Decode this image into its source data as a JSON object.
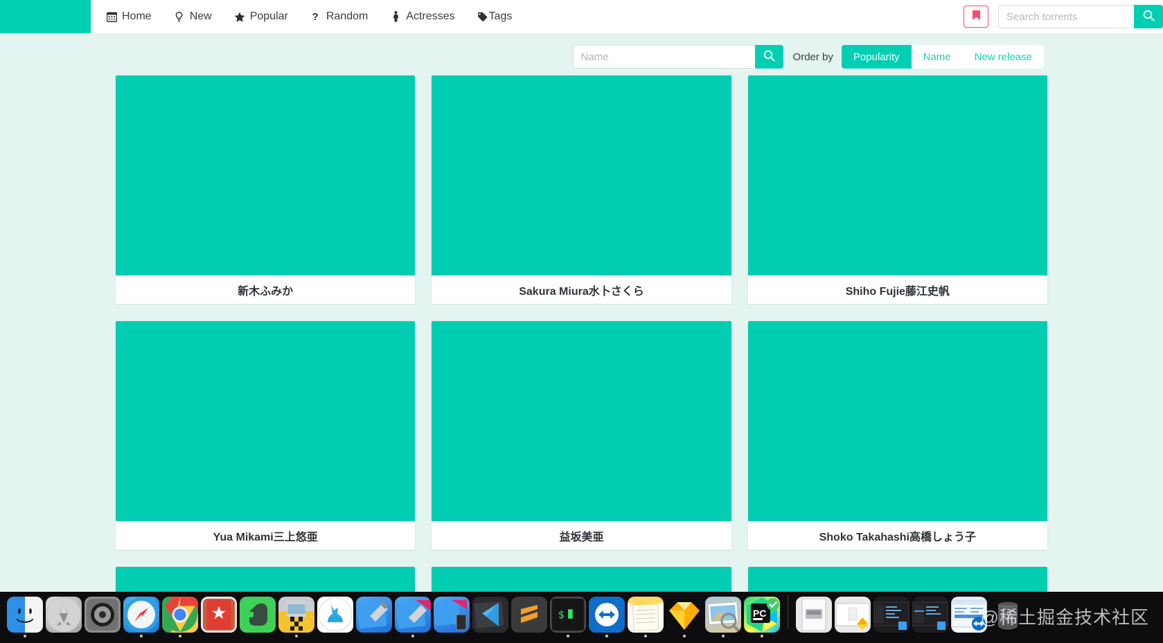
{
  "navbar": {
    "brand": "",
    "links": [
      {
        "label": "Home",
        "icon": "calendar-icon"
      },
      {
        "label": "New",
        "icon": "lightbulb-icon"
      },
      {
        "label": "Popular",
        "icon": "star-icon"
      },
      {
        "label": "Random",
        "icon": "question-mark-icon"
      },
      {
        "label": "Actresses",
        "icon": "person-icon"
      },
      {
        "label": "Tags",
        "icon": "tag-icon"
      }
    ],
    "bookmark_icon": "bookmark-icon",
    "search": {
      "placeholder": "Search torrents",
      "value": "",
      "button_icon": "search-icon"
    }
  },
  "filterbar": {
    "name_search": {
      "placeholder": "Name",
      "value": "",
      "button_icon": "search-icon"
    },
    "order_by_label": "Order by",
    "order_options": [
      {
        "label": "Popularity",
        "active": true
      },
      {
        "label": "Name",
        "active": false
      },
      {
        "label": "New release",
        "active": false
      }
    ]
  },
  "grid": {
    "cards": [
      {
        "title": "新木ふみか",
        "thumb_color": "#00cdb1"
      },
      {
        "title": "Sakura Miura水卜さくら",
        "thumb_color": "#00cdb1"
      },
      {
        "title": "Shiho Fujie藤江史帆",
        "thumb_color": "#00cdb1"
      },
      {
        "title": "Yua Mikami三上悠亜",
        "thumb_color": "#00cdb1"
      },
      {
        "title": "益坂美亜",
        "thumb_color": "#00cdb1"
      },
      {
        "title": "Shoko Takahashi高橋しょう子",
        "thumb_color": "#00cdb1"
      }
    ],
    "partial_row": [
      {
        "title": "",
        "thumb_color": "#00cdb1"
      },
      {
        "title": "",
        "thumb_color": "#00cdb1"
      },
      {
        "title": "",
        "thumb_color": "#00cdb1"
      }
    ]
  },
  "dock": {
    "items": [
      {
        "name": "finder",
        "label": "Finder",
        "running": true
      },
      {
        "name": "launchpad",
        "label": "Launchpad",
        "running": false
      },
      {
        "name": "system-preferences",
        "label": "System Preferences",
        "running": false
      },
      {
        "name": "safari",
        "label": "Safari",
        "running": false
      },
      {
        "name": "google-chrome",
        "label": "Google Chrome",
        "running": true
      },
      {
        "name": "wunderlist",
        "label": "Wunderlist",
        "running": false
      },
      {
        "name": "evernote",
        "label": "Evernote",
        "running": false
      },
      {
        "name": "tower",
        "label": "Tower",
        "running": true
      },
      {
        "name": "kaleidoscope",
        "label": "Kaleidoscope",
        "running": false
      },
      {
        "name": "xcode",
        "label": "Xcode",
        "running": false
      },
      {
        "name": "xcode-beta",
        "label": "Xcode Beta",
        "running": true
      },
      {
        "name": "xcode-beta-simulator",
        "label": "Simulator",
        "running": false
      },
      {
        "name": "visual-studio-code",
        "label": "Visual Studio Code",
        "running": false
      },
      {
        "name": "sublime-text",
        "label": "Sublime Text",
        "running": false
      },
      {
        "name": "terminal",
        "label": "Terminal",
        "running": true
      },
      {
        "name": "teamviewer",
        "label": "TeamViewer",
        "running": true
      },
      {
        "name": "notes",
        "label": "Notes",
        "running": true
      },
      {
        "name": "sketch",
        "label": "Sketch",
        "running": true
      },
      {
        "name": "preview",
        "label": "Preview",
        "running": true
      },
      {
        "name": "pycharm",
        "label": "PyCharm",
        "running": true
      }
    ],
    "minimized": [
      {
        "name": "disk-image-stack",
        "label": "Disk Image"
      },
      {
        "name": "sketch-document",
        "label": "Sketch Document"
      },
      {
        "name": "xcode-window-dark",
        "label": "Xcode Window"
      },
      {
        "name": "xcode-window-dark-2",
        "label": "Xcode Window"
      },
      {
        "name": "teamviewer-window",
        "label": "TeamViewer Window"
      },
      {
        "name": "trash",
        "label": "Trash"
      }
    ],
    "watermark": "@稀土掘金技术社区"
  },
  "colors": {
    "accent": "#00cfb4",
    "thumb": "#00cdb1",
    "page_bg": "#e4f4f1",
    "bookmark": "#fb4a6b",
    "nav_text": "#3c3c3c"
  }
}
